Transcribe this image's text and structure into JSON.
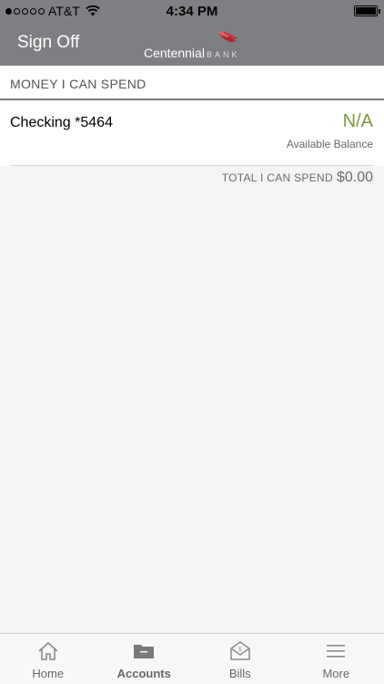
{
  "status_bar": {
    "carrier": "AT&T",
    "time": "4:34 PM"
  },
  "nav": {
    "sign_off_label": "Sign Off",
    "brand_main": "Centennial",
    "brand_sub": "BANK"
  },
  "section": {
    "title": "MONEY I CAN SPEND"
  },
  "accounts": [
    {
      "name": "Checking *5464",
      "value": "N/A",
      "sub_label": "Available Balance"
    }
  ],
  "total": {
    "label": "TOTAL I CAN SPEND",
    "value": "$0.00"
  },
  "tabs": [
    {
      "label": "Home",
      "icon": "home-icon"
    },
    {
      "label": "Accounts",
      "icon": "folder-icon",
      "active": true
    },
    {
      "label": "Bills",
      "icon": "bills-icon"
    },
    {
      "label": "More",
      "icon": "menu-icon"
    }
  ],
  "colors": {
    "header_bg": "#7e7f82",
    "balance_green": "#7a9a3b",
    "logo_red": "#c8343a"
  }
}
